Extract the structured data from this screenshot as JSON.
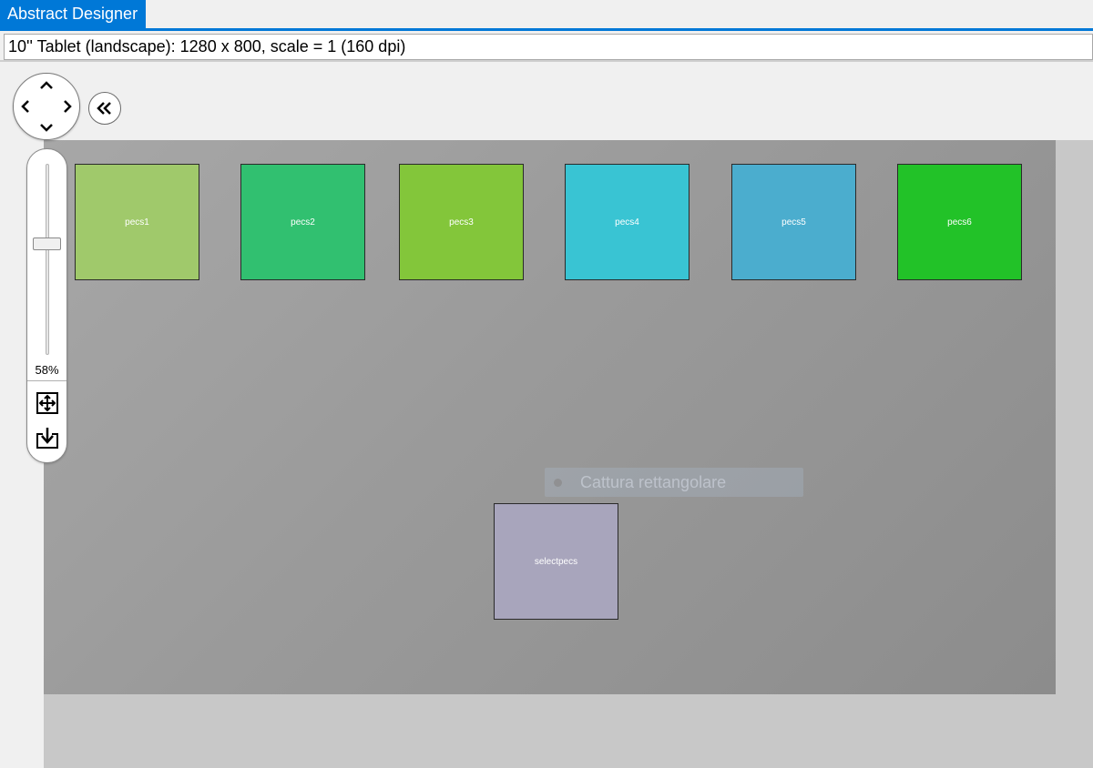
{
  "app": {
    "title": "Abstract Designer",
    "accent_color": "#0078d7"
  },
  "device": {
    "label": "10'' Tablet (landscape): 1280 x 800, scale = 1 (160 dpi)"
  },
  "navigation": {
    "pad_icons": [
      "chevron-up-icon",
      "chevron-left-icon",
      "chevron-right-icon",
      "chevron-down-icon"
    ],
    "collapse_icon": "double-chevron-left-icon"
  },
  "zoom": {
    "level": 0.58,
    "label": "58%",
    "fit_icon": "fit-to-screen-icon",
    "save_icon": "download-icon"
  },
  "tiles": [
    {
      "label": "pecs1",
      "color": "#a0c96b"
    },
    {
      "label": "pecs2",
      "color": "#31c070"
    },
    {
      "label": "pecs3",
      "color": "#83c63a"
    },
    {
      "label": "pecs4",
      "color": "#39c4d3"
    },
    {
      "label": "pecs5",
      "color": "#4badce"
    },
    {
      "label": "pecs6",
      "color": "#22c228"
    },
    {
      "label": "selectpecs",
      "color": "#a8a5bc"
    }
  ],
  "overlay": {
    "capture_label": "Cattura rettangolare"
  }
}
